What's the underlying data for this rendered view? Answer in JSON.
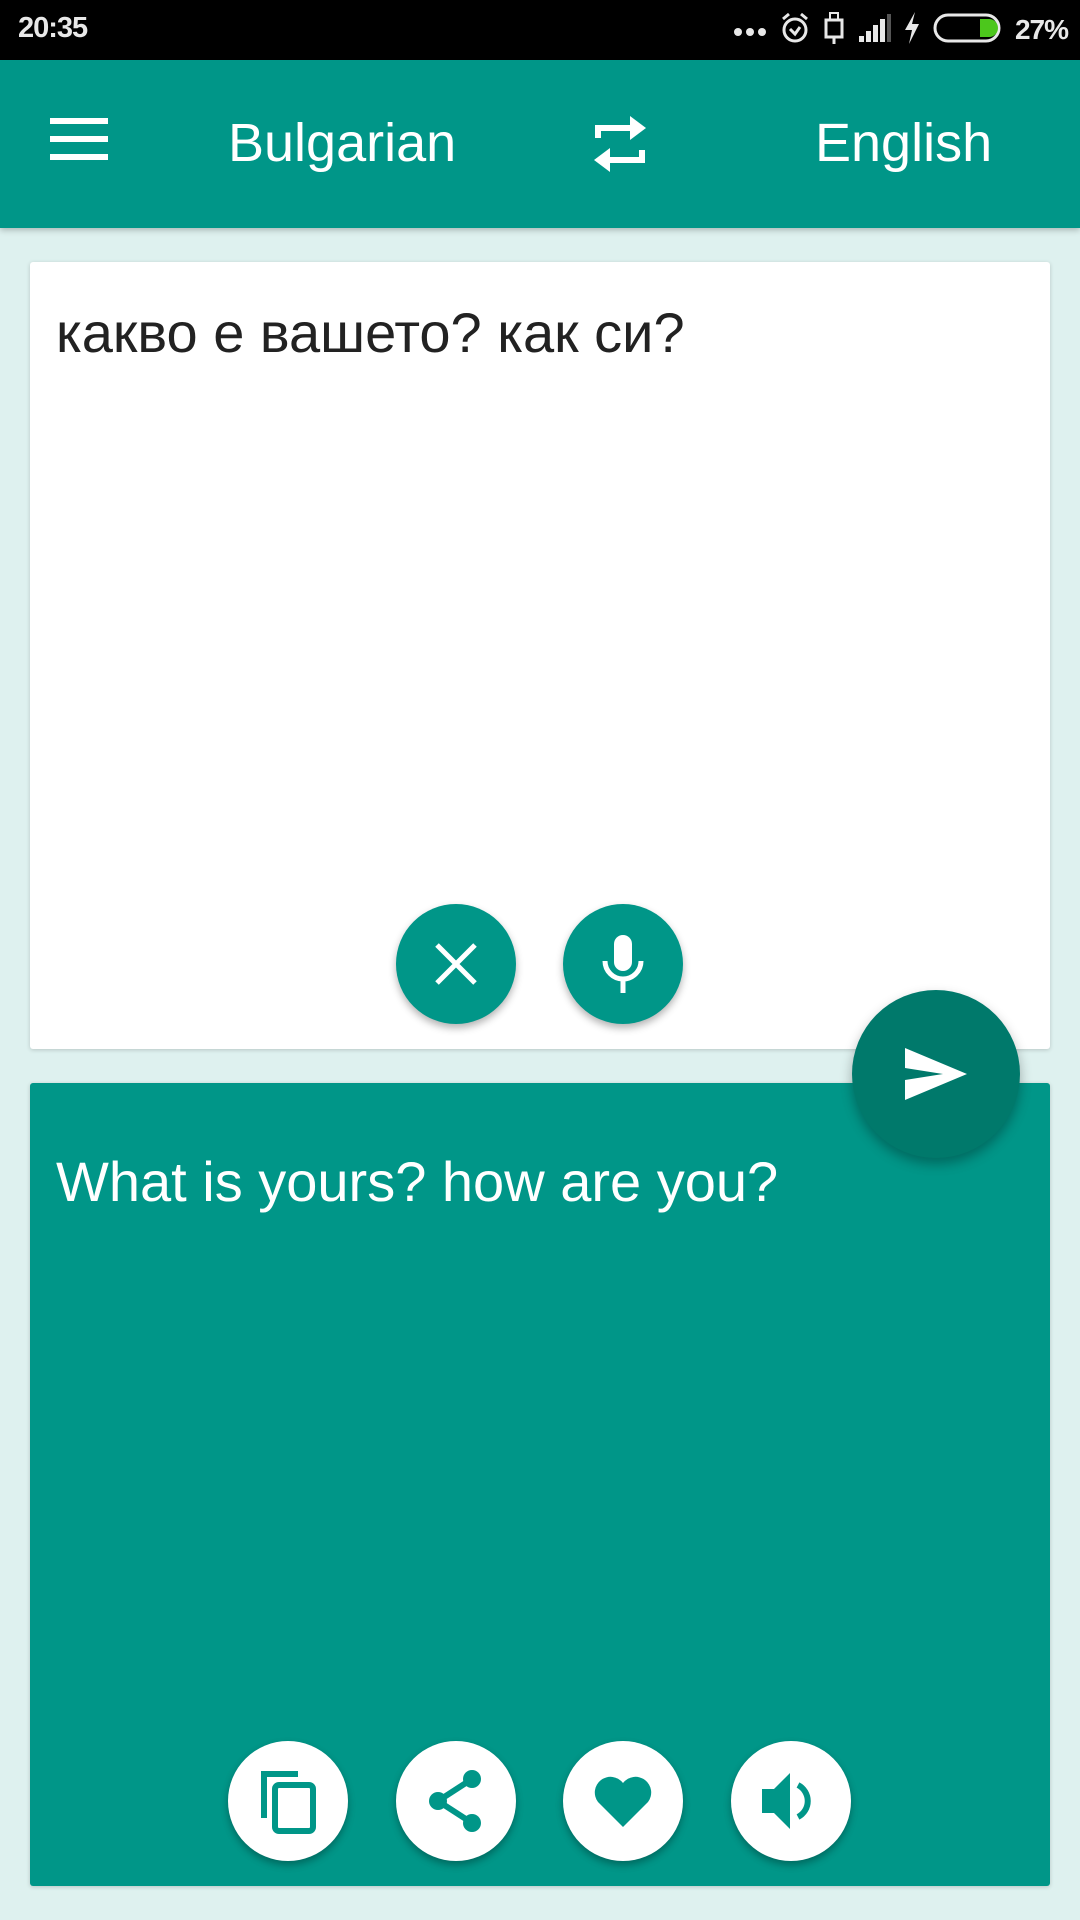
{
  "status_bar": {
    "time": "20:35",
    "battery_percent": "27%",
    "battery_level": 0.27,
    "icons": [
      "more-dots-icon",
      "alarm-icon",
      "usb-icon",
      "signal-icon",
      "charging-icon",
      "battery-icon"
    ]
  },
  "app_bar": {
    "menu_icon": "hamburger-menu-icon",
    "source_language": "Bulgarian",
    "swap_icon": "swap-languages-icon",
    "target_language": "English"
  },
  "input_card": {
    "text": "какво е вашето? как си?",
    "buttons": [
      {
        "name": "clear",
        "icon": "close-icon"
      },
      {
        "name": "voice-input",
        "icon": "microphone-icon"
      }
    ]
  },
  "translate_button": {
    "icon": "send-icon"
  },
  "output_card": {
    "text": "What is yours? how are you?",
    "buttons": [
      {
        "name": "copy",
        "icon": "copy-icon"
      },
      {
        "name": "share",
        "icon": "share-icon"
      },
      {
        "name": "favorite",
        "icon": "heart-icon"
      },
      {
        "name": "speak",
        "icon": "speaker-icon"
      }
    ]
  },
  "colors": {
    "primary": "#009688",
    "primary_dark": "#00796b",
    "background": "#def1ef",
    "battery_fill": "#4cc71c"
  }
}
